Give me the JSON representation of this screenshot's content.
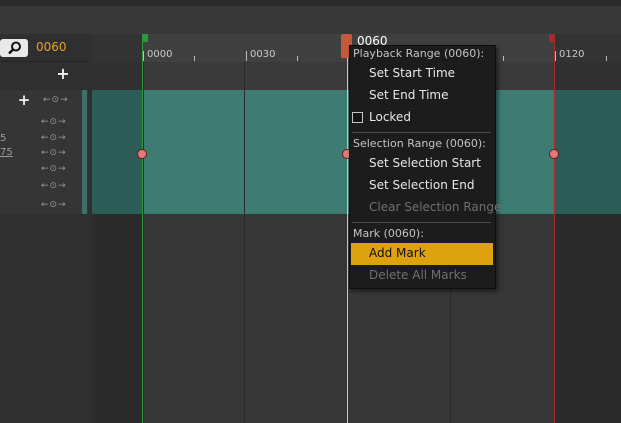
{
  "toolbar": {
    "current_frame": "0060"
  },
  "left_panel": {
    "add_label": "+",
    "nav_arrows": "←⊙→",
    "fragment_1": "5",
    "fragment_2": "75"
  },
  "timeline": {
    "ruler_labels": [
      "0000",
      "0030",
      "0120"
    ],
    "playhead_label": "0060"
  },
  "context_menu": {
    "playback_header": "Playback Range (0060):",
    "set_start_time": "Set Start Time",
    "set_end_time": "Set End Time",
    "locked": "Locked",
    "selection_header": "Selection Range (0060):",
    "set_selection_start": "Set Selection Start",
    "set_selection_end": "Set Selection End",
    "clear_selection_range": "Clear Selection Range",
    "mark_header": "Mark (0060):",
    "add_mark": "Add Mark",
    "delete_all_marks": "Delete All Marks"
  },
  "colors": {
    "accent_orange": "#e5a32a",
    "highlight": "#dfa20f",
    "track_teal": "#3d7b73",
    "playback_start": "#2a9a3d",
    "playback_end": "#a82a2a",
    "key": "#e27a7a"
  },
  "icons": {
    "search": "search-icon",
    "add": "plus-icon",
    "nav": "key-navigation-icon"
  }
}
